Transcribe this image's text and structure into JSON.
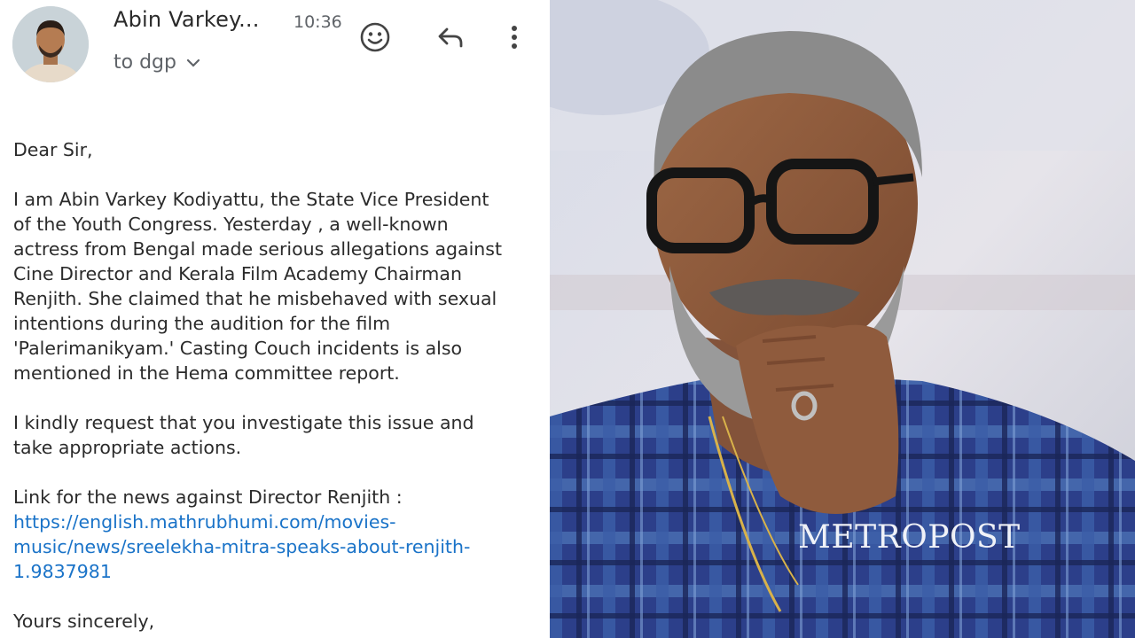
{
  "email": {
    "sender_name": "Abin Varkey...",
    "time": "10:36",
    "recipient": "to dgp",
    "icons": [
      "emoji-icon",
      "reply-icon",
      "more-vert-icon",
      "chevron-down-icon"
    ],
    "greeting": "Dear Sir,",
    "paragraph1": [
      "I am Abin Varkey Kodiyattu, the State Vice President",
      "of the Youth Congress. Yesterday , a well-known",
      "actress from Bengal made serious allegations against",
      "Cine Director and Kerala Film Academy Chairman",
      "Renjith. She claimed that he misbehaved with sexual",
      "intentions during the audition for the film",
      "'Palerimanikyam.' Casting Couch incidents is also",
      "mentioned in the Hema committee report."
    ],
    "paragraph2": [
      "I kindly request that you investigate this issue and",
      "take appropriate actions."
    ],
    "link_intro": "Link for the news against Director Renjith :",
    "link_lines": [
      "https://english.mathrubhumi.com/movies-",
      "music/news/sreelekha-mitra-speaks-about-renjith-",
      "1.9837981"
    ],
    "closing": "Yours sincerely,",
    "link_color": "#1a73c8"
  },
  "photo": {
    "watermark": "METROPOST"
  }
}
